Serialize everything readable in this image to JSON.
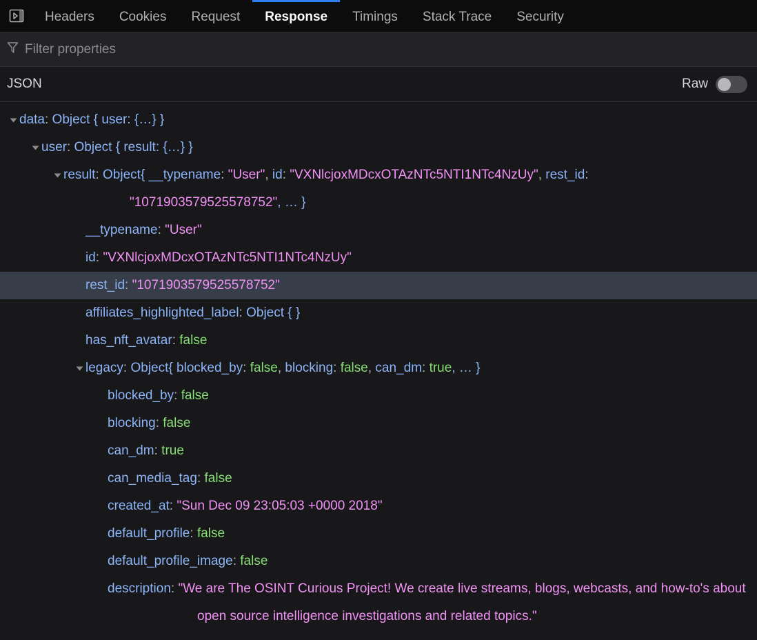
{
  "tabs": [
    {
      "label": "Headers",
      "active": false
    },
    {
      "label": "Cookies",
      "active": false
    },
    {
      "label": "Request",
      "active": false
    },
    {
      "label": "Response",
      "active": true
    },
    {
      "label": "Timings",
      "active": false
    },
    {
      "label": "Stack Trace",
      "active": false
    },
    {
      "label": "Security",
      "active": false
    }
  ],
  "panel_toggle_icon": "expand-panes-icon",
  "filter": {
    "icon": "funnel-icon",
    "value": "",
    "placeholder": "Filter properties"
  },
  "viewer": {
    "label": "JSON",
    "raw_label": "Raw",
    "raw_enabled": false
  },
  "colors": {
    "background": "#18181a",
    "tabbar_background": "#0c0c0d",
    "filterbar_background": "#232327",
    "accent": "#2f7ff0",
    "key": "#8cb4f8",
    "string": "#f191f5",
    "boolean": "#86de74",
    "selected_row": "#373d49",
    "text": "#b1b1b3"
  },
  "tree": {
    "data_key": "data",
    "data_summary_type": "Object",
    "data_summary_body": "{ user: {…} }",
    "user_key": "user",
    "user_summary_type": "Object",
    "user_summary_body": "{ result: {…} }",
    "result_key": "result",
    "result_summary_type": "Object",
    "result_summary_open": "{ ",
    "result_summary_k1": "__typename",
    "result_summary_v1": "\"User\"",
    "result_summary_k2": "id",
    "result_summary_v2": "\"VXNlcjoxMDcxOTAzNTc5NTI1NTc4NzUy\"",
    "result_summary_k3": "rest_id",
    "result_summary_v3": "\"1071903579525578752\"",
    "result_summary_tail": ", … }",
    "typename_key": "__typename",
    "typename_value": "\"User\"",
    "id_key": "id",
    "id_value": "\"VXNlcjoxMDcxOTAzNTc5NTI1NTc4NzUy\"",
    "rest_id_key": "rest_id",
    "rest_id_value": "\"1071903579525578752\"",
    "affiliates_key": "affiliates_highlighted_label",
    "affiliates_value": "Object { }",
    "has_nft_key": "has_nft_avatar",
    "has_nft_value": "false",
    "legacy_key": "legacy",
    "legacy_summary_type": "Object",
    "legacy_summary_open": "{ ",
    "legacy_s_k1": "blocked_by",
    "legacy_s_v1": "false",
    "legacy_s_k2": "blocking",
    "legacy_s_v2": "false",
    "legacy_s_k3": "can_dm",
    "legacy_s_v3": "true",
    "legacy_summary_tail": ", … }",
    "blocked_by_key": "blocked_by",
    "blocked_by_value": "false",
    "blocking_key": "blocking",
    "blocking_value": "false",
    "can_dm_key": "can_dm",
    "can_dm_value": "true",
    "can_media_tag_key": "can_media_tag",
    "can_media_tag_value": "false",
    "created_at_key": "created_at",
    "created_at_value": "\"Sun Dec 09 23:05:03 +0000 2018\"",
    "default_profile_key": "default_profile",
    "default_profile_value": "false",
    "default_profile_image_key": "default_profile_image",
    "default_profile_image_value": "false",
    "description_key": "description",
    "description_value": "\"We are The OSINT Curious Project! We create live streams, blogs, webcasts, and how-to's about open source intelligence investigations and related topics.\""
  }
}
